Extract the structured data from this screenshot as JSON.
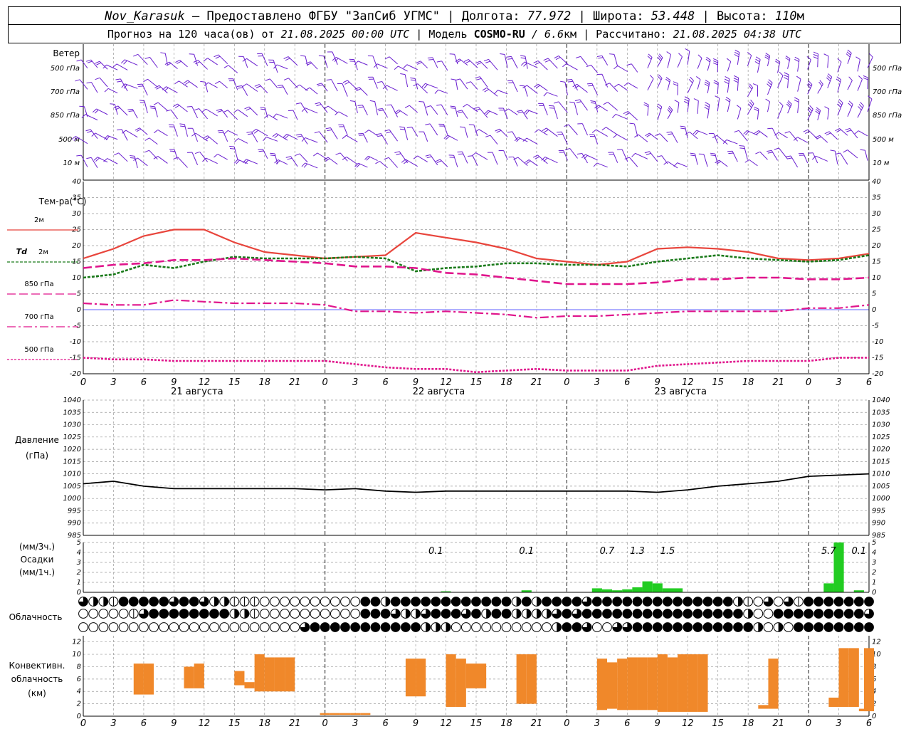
{
  "header": {
    "station": "Nov_Karasuk",
    "provider": " – Предоставлено ФГБУ \"ЗапСиб УГМС\" | Долгота: ",
    "lon": "77.972",
    "lat_label": " | Широта: ",
    "lat": "53.448",
    "alt_label": " | Высота: ",
    "alt": "110",
    "alt_unit": "м",
    "forecast_label": "Прогноз на 120 часа(ов) от ",
    "forecast_time": "21.08.2025 00:00 UTC",
    "model_label": " | Модель ",
    "model_name": "COSMO-RU",
    "model_res": " / 6.6",
    "model_res_unit": "км",
    "calc_label": " | Рассчитано: ",
    "calc_time": "21.08.2025 04:38 UTC"
  },
  "colors": {
    "wind": "#6a1fd0",
    "t2m": "#e8453c",
    "td2m": "#1a7a1a",
    "t850": "#e0158c",
    "t700": "#e0158c",
    "t500": "#e0158c",
    "pressure": "#000000",
    "precip": "#22cc22",
    "conv": "#f0882a",
    "grid": "#9a9a9a",
    "zero_line": "#2a2aff"
  },
  "chart_data": [
    {
      "type": "wind_barbs",
      "title": "Ветер",
      "levels": [
        "500 гПа",
        "700 гПа",
        "850 гПа",
        "500 м",
        "10 м"
      ]
    },
    {
      "type": "line",
      "title": "Тем-ра(°C)",
      "ylim": [
        -20,
        40
      ],
      "yticks": [
        40,
        35,
        30,
        25,
        20,
        15,
        10,
        5,
        0,
        -5,
        -10,
        -15,
        -20
      ],
      "x_hour_labels": [
        "0",
        "3",
        "6",
        "9",
        "12",
        "15",
        "18",
        "21",
        "0",
        "3",
        "6",
        "9",
        "12",
        "15",
        "18",
        "21",
        "0",
        "3",
        "6",
        "9",
        "12",
        "15",
        "18",
        "21",
        "0",
        "3",
        "6"
      ],
      "day_labels": [
        "21 августа",
        "22 августа",
        "23 августа"
      ],
      "legend": [
        {
          "key": "t2m",
          "label": "2м"
        },
        {
          "key": "td2m",
          "label_italic": "Td",
          "label": "2м"
        },
        {
          "key": "t850",
          "label": "850 гПа"
        },
        {
          "key": "t700",
          "label": "700 гПа"
        },
        {
          "key": "t500",
          "label": "500 гПа"
        }
      ],
      "x_hours": [
        0,
        3,
        6,
        9,
        12,
        15,
        18,
        21,
        24,
        27,
        30,
        33,
        36,
        39,
        42,
        45,
        48,
        51,
        54,
        57,
        60,
        63,
        66,
        69,
        72,
        75,
        78
      ],
      "series": [
        {
          "key": "t2m",
          "values": [
            16,
            19,
            23,
            25,
            25,
            21,
            18,
            17,
            16,
            16.5,
            17,
            24,
            22.5,
            21,
            19,
            16,
            15,
            14,
            15,
            19,
            19.5,
            19,
            18,
            16,
            15.5,
            16,
            17.5
          ]
        },
        {
          "key": "td2m",
          "values": [
            10,
            11,
            14,
            13,
            15,
            16.5,
            16,
            16,
            16,
            16.5,
            16,
            12,
            13,
            13.5,
            14.5,
            14.5,
            14,
            14,
            13.5,
            15,
            16,
            17,
            16,
            15.5,
            15,
            15.5,
            17
          ]
        },
        {
          "key": "t850",
          "values": [
            13,
            14,
            14.5,
            15.5,
            15.5,
            16,
            15.5,
            15,
            14.5,
            13.5,
            13.5,
            13,
            11.5,
            11,
            10,
            9,
            8,
            8,
            8,
            8.5,
            9.5,
            9.5,
            10,
            10,
            9.5,
            9.5,
            10
          ]
        },
        {
          "key": "t700",
          "values": [
            2,
            1.5,
            1.5,
            3,
            2.5,
            2,
            2,
            2,
            1.5,
            -0.5,
            -0.5,
            -1,
            -0.5,
            -1,
            -1.5,
            -2.5,
            -2,
            -2,
            -1.5,
            -1,
            -0.5,
            -0.5,
            -0.5,
            -0.5,
            0.5,
            0.5,
            1.5
          ]
        },
        {
          "key": "t500",
          "values": [
            -15,
            -15.5,
            -15.5,
            -16,
            -16,
            -16,
            -16,
            -16,
            -16,
            -17,
            -18,
            -18.5,
            -18.5,
            -19.5,
            -19,
            -18.5,
            -19,
            -19,
            -19,
            -17.5,
            -17,
            -16.5,
            -16,
            -16,
            -16,
            -15,
            -15
          ]
        }
      ]
    },
    {
      "type": "line",
      "title": "Давление",
      "unit": "(гПа)",
      "ylim": [
        985,
        1040
      ],
      "yticks": [
        1040,
        1035,
        1030,
        1025,
        1020,
        1015,
        1010,
        1005,
        1000,
        995,
        990,
        985
      ],
      "x_hours": [
        0,
        3,
        6,
        9,
        12,
        15,
        18,
        21,
        24,
        27,
        30,
        33,
        36,
        39,
        42,
        45,
        48,
        51,
        54,
        57,
        60,
        63,
        66,
        69,
        72,
        75,
        78
      ],
      "values": [
        1006,
        1007,
        1005,
        1004,
        1004,
        1004,
        1004,
        1004,
        1003.5,
        1004,
        1003,
        1002.5,
        1003,
        1003,
        1003,
        1003,
        1003,
        1003,
        1003,
        1002.5,
        1003.5,
        1005,
        1006,
        1007,
        1009,
        1009.5,
        1010
      ]
    },
    {
      "type": "bar",
      "title": "Осадки",
      "unit_top": "(мм/3ч.)",
      "unit_bottom": "(мм/1ч.)",
      "ylim": [
        0,
        5
      ],
      "yticks": [
        5,
        4,
        3,
        2,
        1,
        0
      ],
      "hours": [
        36,
        44,
        51,
        52,
        53,
        54,
        55,
        56,
        57,
        58,
        59,
        74,
        75,
        77
      ],
      "values": [
        0.1,
        0.2,
        0.4,
        0.3,
        0.2,
        0.3,
        0.5,
        1.1,
        0.9,
        0.4,
        0.4,
        0.9,
        5,
        0.2
      ],
      "labels_3h": [
        {
          "hour": 35,
          "text": "0.1"
        },
        {
          "hour": 44,
          "text": "0.1"
        },
        {
          "hour": 52,
          "text": "0.7"
        },
        {
          "hour": 55,
          "text": "1.3"
        },
        {
          "hour": 58,
          "text": "1.5"
        },
        {
          "hour": 74,
          "text": "5.7"
        },
        {
          "hour": 77,
          "text": "0.1"
        }
      ]
    },
    {
      "type": "symbols",
      "title": "Облачность",
      "rows": [
        [
          3,
          2,
          2,
          1,
          4,
          4,
          4,
          4,
          4,
          3,
          4,
          4,
          3,
          2,
          2,
          1,
          1,
          1,
          0,
          0,
          0,
          0,
          0,
          0,
          0,
          0,
          0,
          0,
          4,
          4,
          2,
          4,
          4,
          4,
          4,
          4,
          4,
          4,
          4,
          4,
          4,
          4,
          4,
          2,
          4,
          2,
          4,
          4,
          4,
          4,
          3,
          4,
          4,
          4,
          4,
          4,
          4,
          4,
          4,
          4,
          4,
          4,
          4,
          4,
          4,
          2,
          1,
          0,
          3,
          0,
          3,
          1,
          4,
          4,
          4,
          4,
          4,
          4,
          4
        ],
        [
          0,
          0,
          0,
          0,
          0,
          1,
          3,
          4,
          4,
          4,
          4,
          4,
          4,
          4,
          4,
          2,
          2,
          1,
          0,
          0,
          0,
          0,
          0,
          0,
          0,
          0,
          0,
          0,
          4,
          4,
          4,
          3,
          2,
          2,
          3,
          4,
          4,
          4,
          3,
          4,
          2,
          4,
          4,
          2,
          2,
          2,
          2,
          3,
          4,
          3,
          4,
          4,
          4,
          4,
          4,
          4,
          4,
          4,
          4,
          4,
          4,
          4,
          4,
          4,
          4,
          4,
          2,
          0,
          0,
          4,
          4,
          4,
          4,
          4,
          4,
          4,
          4,
          4,
          3
        ],
        [
          0,
          0,
          0,
          0,
          0,
          0,
          0,
          0,
          0,
          0,
          0,
          0,
          0,
          0,
          0,
          0,
          0,
          0,
          0,
          0,
          0,
          0,
          3,
          4,
          4,
          4,
          4,
          4,
          4,
          4,
          4,
          4,
          4,
          4,
          2,
          2,
          2,
          0,
          0,
          0,
          0,
          0,
          0,
          0,
          0,
          0,
          0,
          2,
          4,
          4,
          3,
          0,
          0,
          3,
          3,
          4,
          4,
          4,
          4,
          4,
          4,
          4,
          4,
          4,
          4,
          4,
          4,
          2,
          0,
          2,
          0,
          4,
          4,
          4,
          4,
          4,
          4,
          4,
          4
        ]
      ]
    },
    {
      "type": "bar",
      "title": "Конвективн. облачность (км)",
      "ylim": [
        0,
        13
      ],
      "yticks": [
        12,
        10,
        8,
        6,
        4,
        2,
        0
      ],
      "cells": [
        {
          "hour": 5.5,
          "base": 3.5,
          "top": 8.5
        },
        {
          "hour": 6.5,
          "base": 3.5,
          "top": 8.5
        },
        {
          "hour": 10.5,
          "base": 4.5,
          "top": 8
        },
        {
          "hour": 11.5,
          "base": 4.5,
          "top": 8.5
        },
        {
          "hour": 15.5,
          "base": 5,
          "top": 7.3
        },
        {
          "hour": 16.5,
          "base": 4.5,
          "top": 5.5
        },
        {
          "hour": 17.5,
          "base": 4,
          "top": 10
        },
        {
          "hour": 18.5,
          "base": 4,
          "top": 9.5
        },
        {
          "hour": 19.5,
          "base": 4,
          "top": 9.5
        },
        {
          "hour": 20.5,
          "base": 4,
          "top": 9.5
        },
        {
          "hour": 24,
          "base": 0.2,
          "top": 0.5
        },
        {
          "hour": 25,
          "base": 0.2,
          "top": 0.5
        },
        {
          "hour": 26,
          "base": 0.2,
          "top": 0.5
        },
        {
          "hour": 27,
          "base": 0.2,
          "top": 0.5
        },
        {
          "hour": 28,
          "base": 0.2,
          "top": 0.5
        },
        {
          "hour": 32.5,
          "base": 3.2,
          "top": 9.3
        },
        {
          "hour": 33.5,
          "base": 3.2,
          "top": 9.3
        },
        {
          "hour": 36.5,
          "base": 1.5,
          "top": 10
        },
        {
          "hour": 37.5,
          "base": 1.5,
          "top": 9.3
        },
        {
          "hour": 38.5,
          "base": 4.5,
          "top": 8.5
        },
        {
          "hour": 39.5,
          "base": 4.5,
          "top": 8.5
        },
        {
          "hour": 43.5,
          "base": 2,
          "top": 10
        },
        {
          "hour": 44.5,
          "base": 2,
          "top": 10
        },
        {
          "hour": 51.5,
          "base": 1,
          "top": 9.3
        },
        {
          "hour": 52.5,
          "base": 1.2,
          "top": 8.7
        },
        {
          "hour": 53.5,
          "base": 1,
          "top": 9.3
        },
        {
          "hour": 54.5,
          "base": 1,
          "top": 9.5
        },
        {
          "hour": 55.5,
          "base": 1,
          "top": 9.5
        },
        {
          "hour": 56.5,
          "base": 1,
          "top": 9.5
        },
        {
          "hour": 57.5,
          "base": 0.7,
          "top": 10
        },
        {
          "hour": 58.5,
          "base": 0.7,
          "top": 9.5
        },
        {
          "hour": 59.5,
          "base": 0.7,
          "top": 10
        },
        {
          "hour": 60.5,
          "base": 0.7,
          "top": 10
        },
        {
          "hour": 61.5,
          "base": 0.7,
          "top": 10
        },
        {
          "hour": 67.5,
          "base": 1.2,
          "top": 1.8
        },
        {
          "hour": 68.5,
          "base": 1.2,
          "top": 9.3
        },
        {
          "hour": 74.5,
          "base": 1.5,
          "top": 3
        },
        {
          "hour": 75.5,
          "base": 1.5,
          "top": 11
        },
        {
          "hour": 76.5,
          "base": 1.5,
          "top": 11
        },
        {
          "hour": 77.5,
          "base": 0.8,
          "top": 1.2
        },
        {
          "hour": 78,
          "base": 0.8,
          "top": 11
        }
      ]
    }
  ]
}
